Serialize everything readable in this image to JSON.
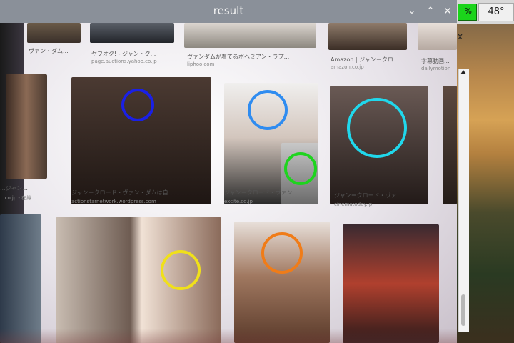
{
  "window": {
    "title": "result",
    "minimize_glyph": "⌄",
    "maximize_glyph": "⌃",
    "close_glyph": "✕"
  },
  "panel": {
    "cpu_label": "%",
    "temperature": "48°",
    "bg_close_glyph": "x"
  },
  "results": {
    "top_row": [
      {
        "title": "ヴァン・ダム...",
        "source": ""
      },
      {
        "title": "ヤフオク! - ジャン・ク...",
        "source": "page.auctions.yahoo.co.jp"
      },
      {
        "title": "ヴァンダムが着てるボヘミアン・ラプ...",
        "source": "liphoo.com"
      },
      {
        "title": "Amazon | ジャン＝クロ...",
        "source": "amazon.co.jp"
      },
      {
        "title": "字幕動画...",
        "source": "dailymotion"
      }
    ],
    "middle_row": [
      {
        "title": "...ジャン...",
        "source": "...co.jp - 在線"
      },
      {
        "title": "ジャン＝クロード・ヴァン・ダムは自...",
        "source": "actionstarnetwork.wordpress.com"
      },
      {
        "title": "ジャン＝クロード・ヴァン...",
        "source": "excite.co.jp"
      },
      {
        "title": "ジャン＝クロード・ヴァ...",
        "source": "cinematoday.jp"
      }
    ]
  },
  "detections": [
    {
      "color": "#1a20e6"
    },
    {
      "color": "#2f8cf0"
    },
    {
      "color": "#1ed41e"
    },
    {
      "color": "#20d8ec"
    },
    {
      "color": "#f0e01a"
    },
    {
      "color": "#f07c18"
    }
  ]
}
